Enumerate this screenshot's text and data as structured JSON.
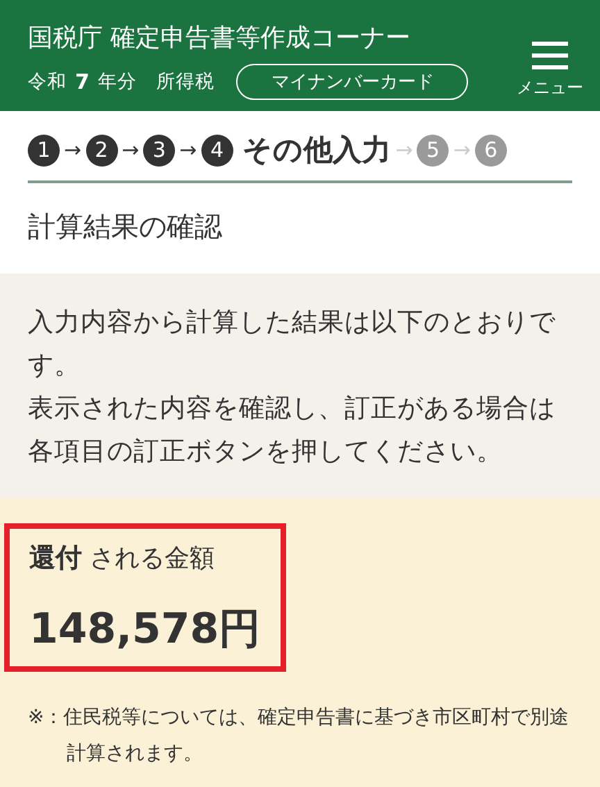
{
  "header": {
    "title": "国税庁 確定申告書等作成コーナー",
    "era": "令和",
    "year": "7",
    "year_suffix": "年分",
    "tax_type": "所得税",
    "card_button": "マイナンバーカード",
    "menu_label": "メニュー"
  },
  "steps": [
    {
      "number": "1",
      "kind": "done"
    },
    {
      "number": "2",
      "kind": "done"
    },
    {
      "number": "3",
      "kind": "done"
    },
    {
      "number": "4",
      "kind": "current",
      "label": "その他入力"
    },
    {
      "number": "5",
      "kind": "upcoming"
    },
    {
      "number": "6",
      "kind": "upcoming"
    }
  ],
  "step_arrow": "→",
  "heading": "計算結果の確認",
  "intro": [
    "入力内容から計算した結果は以下のとおりです。",
    "表示された内容を確認し、訂正がある場合は各項目の訂正ボタンを押してください。"
  ],
  "result": {
    "label": "**還付** される金額",
    "amount": "148,578円",
    "highlighted": true
  },
  "note": "※：住民税等については、確定申告書に基づき市区町村で別途計算されます。"
}
